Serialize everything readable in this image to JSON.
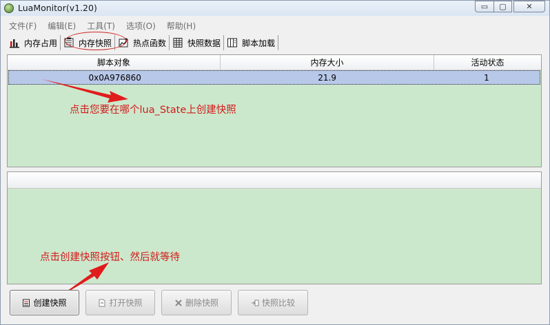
{
  "window": {
    "title": "LuaMonitor(v1.20)",
    "min_glyph": "▭",
    "max_glyph": "▢",
    "close_glyph": "✕"
  },
  "menu": [
    "文件(F)",
    "编辑(E)",
    "工具(T)",
    "选项(O)",
    "帮助(H)"
  ],
  "tabs": [
    {
      "label": "内存占用",
      "icon": "bar-chart-icon"
    },
    {
      "label": "内存快照",
      "icon": "snapshot-icon",
      "active": true
    },
    {
      "label": "热点函数",
      "icon": "hotspot-icon"
    },
    {
      "label": "快照数据",
      "icon": "table-icon"
    },
    {
      "label": "脚本加载",
      "icon": "script-icon"
    }
  ],
  "state_table": {
    "headers": [
      "脚本对象",
      "内存大小",
      "活动状态"
    ],
    "rows": [
      {
        "object": "0x0A976860",
        "memory": "21.9",
        "active": "1",
        "selected": true
      }
    ]
  },
  "annotations": {
    "select_state": "点击您要在哪个lua_State上创建快照",
    "click_create": "点击创建快照按钮、然后就等待"
  },
  "buttons": {
    "create": "创建快照",
    "open": "打开快照",
    "delete": "删除快照",
    "compare": "快照比较"
  },
  "colors": {
    "panel_bg": "#cce8cc",
    "selection": "#b8c8e8",
    "annotation": "#d11a1a"
  }
}
